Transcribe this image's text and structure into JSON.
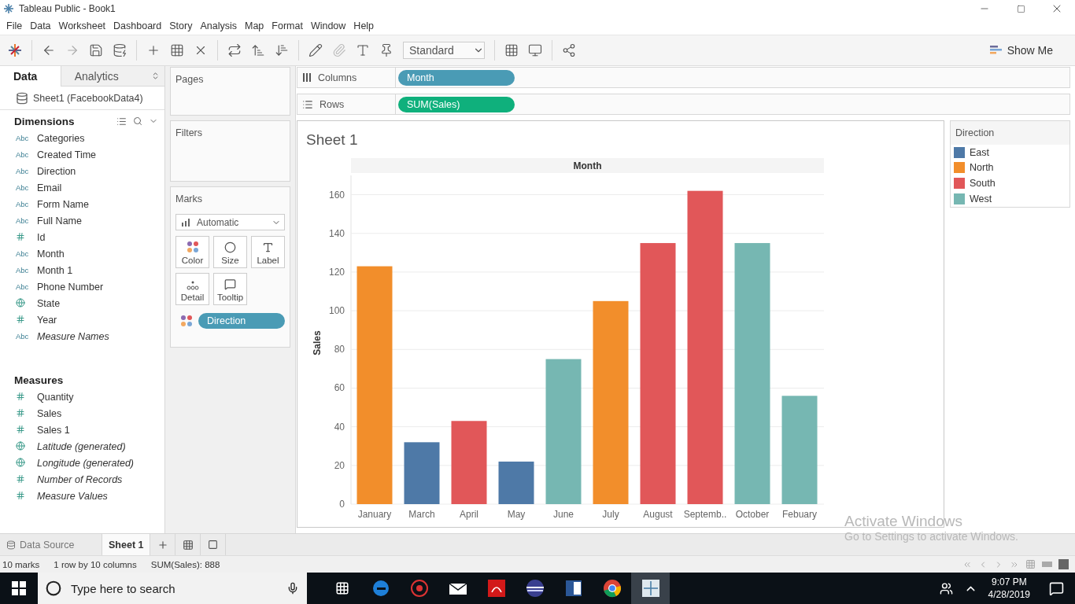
{
  "window": {
    "title": "Tableau Public - Book1"
  },
  "menu": [
    "File",
    "Data",
    "Worksheet",
    "Dashboard",
    "Story",
    "Analysis",
    "Map",
    "Format",
    "Window",
    "Help"
  ],
  "toolbar": {
    "fit": "Standard",
    "show_me": "Show Me"
  },
  "data_pane": {
    "tabs": [
      {
        "label": "Data",
        "selected": true
      },
      {
        "label": "Analytics",
        "selected": false
      }
    ],
    "source": "Sheet1 (FacebookData4)",
    "dimensions": {
      "title": "Dimensions",
      "items": [
        {
          "kind": "text",
          "badge": "Abc",
          "name": "Categories",
          "italic": false
        },
        {
          "kind": "text",
          "badge": "Abc",
          "name": "Created Time",
          "italic": false
        },
        {
          "kind": "text",
          "badge": "Abc",
          "name": "Direction",
          "italic": false
        },
        {
          "kind": "text",
          "badge": "Abc",
          "name": "Email",
          "italic": false
        },
        {
          "kind": "text",
          "badge": "Abc",
          "name": "Form Name",
          "italic": false
        },
        {
          "kind": "text",
          "badge": "Abc",
          "name": "Full Name",
          "italic": false
        },
        {
          "kind": "number",
          "name": "Id",
          "italic": false
        },
        {
          "kind": "text",
          "badge": "Abc",
          "name": "Month",
          "italic": false
        },
        {
          "kind": "text",
          "badge": "Abc",
          "name": "Month 1",
          "italic": false
        },
        {
          "kind": "text",
          "badge": "Abc",
          "name": "Phone Number",
          "italic": false
        },
        {
          "kind": "geo",
          "name": "State",
          "italic": false
        },
        {
          "kind": "number",
          "name": "Year",
          "italic": false
        },
        {
          "kind": "text",
          "badge": "Abc",
          "name": "Measure Names",
          "italic": true
        }
      ]
    },
    "measures": {
      "title": "Measures",
      "items": [
        {
          "kind": "number",
          "name": "Quantity",
          "italic": false
        },
        {
          "kind": "number",
          "name": "Sales",
          "italic": false
        },
        {
          "kind": "number",
          "name": "Sales 1",
          "italic": false
        },
        {
          "kind": "geo",
          "name": "Latitude (generated)",
          "italic": true
        },
        {
          "kind": "geo",
          "name": "Longitude (generated)",
          "italic": true
        },
        {
          "kind": "calc",
          "name": "Number of Records",
          "italic": true
        },
        {
          "kind": "number",
          "name": "Measure Values",
          "italic": true
        }
      ]
    }
  },
  "cards": {
    "pages": "Pages",
    "filters": "Filters",
    "marks": {
      "title": "Marks",
      "mark_type": "Automatic",
      "buttons": [
        {
          "kind": "color",
          "label": "Color"
        },
        {
          "kind": "size",
          "label": "Size"
        },
        {
          "kind": "label",
          "label": "Label"
        },
        {
          "kind": "detail",
          "label": "Detail"
        },
        {
          "kind": "tooltip",
          "label": "Tooltip"
        }
      ],
      "pill": "Direction"
    }
  },
  "shelves": [
    {
      "kind": "columns",
      "label": "Columns",
      "pill": "Month"
    },
    {
      "kind": "rows",
      "label": "Rows",
      "pill": "SUM(Sales)"
    }
  ],
  "sheet": {
    "title": "Sheet 1",
    "header": "Month",
    "chart_data": {
      "type": "bar",
      "ylabel": "Sales",
      "categories": [
        "January",
        "March",
        "April",
        "May",
        "June",
        "July",
        "August",
        "Septemb..",
        "October",
        "Febuary"
      ],
      "series": [
        {
          "name": "East",
          "color": "#4e79a7",
          "values": [
            null,
            32,
            null,
            22,
            null,
            null,
            null,
            null,
            null,
            null
          ]
        },
        {
          "name": "North",
          "color": "#f28e2b",
          "values": [
            123,
            null,
            null,
            null,
            null,
            105,
            null,
            null,
            null,
            null
          ]
        },
        {
          "name": "South",
          "color": "#e15759",
          "values": [
            null,
            null,
            43,
            null,
            null,
            null,
            135,
            162,
            null,
            null
          ]
        },
        {
          "name": "West",
          "color": "#76b7b2",
          "values": [
            null,
            null,
            null,
            null,
            75,
            null,
            null,
            null,
            135,
            56
          ]
        }
      ],
      "ylim": [
        0,
        170
      ],
      "yticks": [
        0,
        20,
        40,
        60,
        80,
        100,
        120,
        140,
        160
      ],
      "grid": true
    }
  },
  "legend": {
    "title": "Direction"
  },
  "sheet_tabs": [
    {
      "label": "Data Source",
      "selected": false
    },
    {
      "label": "Sheet 1",
      "selected": true
    }
  ],
  "status": [
    "10 marks",
    "1 row by 10 columns",
    "SUM(Sales): 888"
  ],
  "activation": {
    "title": "Activate Windows",
    "text": "Go to Settings to activate Windows."
  },
  "taskbar": {
    "search_placeholder": "Type here to search",
    "time": "9:07 PM",
    "date": "4/28/2019"
  }
}
